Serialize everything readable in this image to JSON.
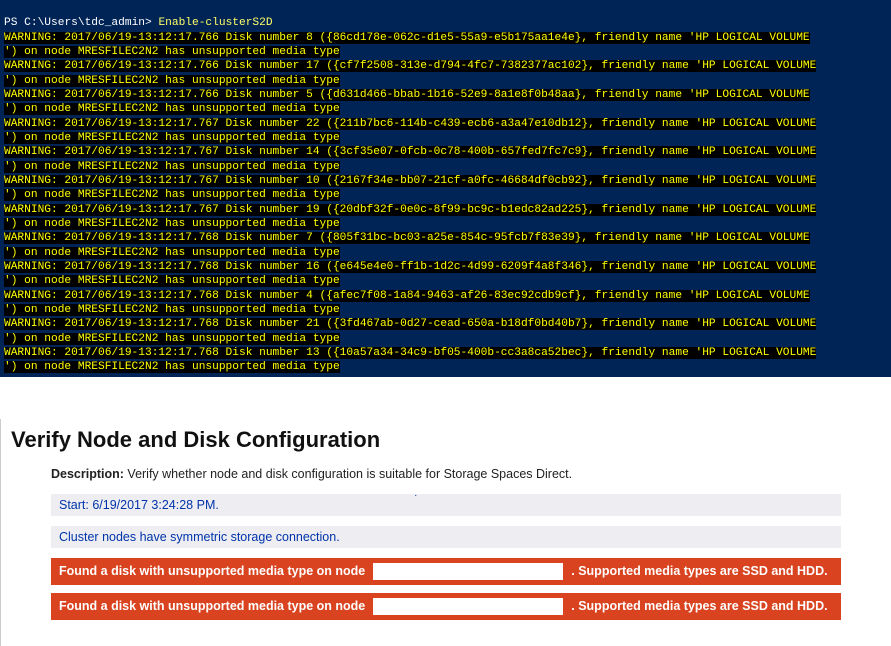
{
  "terminal": {
    "prompt_prefix": "PS ",
    "prompt_path": "C:\\Users\\tdc_admin>",
    "command": "Enable-clusterS2D",
    "node": "MRESFILEC2N2",
    "friendly_name": "HP LOGICAL VOLUME",
    "suffix_msg": "has unsupported media type",
    "warnings": [
      {
        "ts": "2017/06/19-13:12:17.766",
        "disk": "8",
        "guid": "{86cd178e-062c-d1e5-55a9-e5b175aa1e4e}"
      },
      {
        "ts": "2017/06/19-13:12:17.766",
        "disk": "17",
        "guid": "{cf7f2508-313e-d794-4fc7-7382377ac102}"
      },
      {
        "ts": "2017/06/19-13:12:17.766",
        "disk": "5",
        "guid": "{d631d466-bbab-1b16-52e9-8a1e8f0b48aa}"
      },
      {
        "ts": "2017/06/19-13:12:17.767",
        "disk": "22",
        "guid": "{211b7bc6-114b-c439-ecb6-a3a47e10db12}"
      },
      {
        "ts": "2017/06/19-13:12:17.767",
        "disk": "14",
        "guid": "{3cf35e07-0fcb-0c78-400b-657fed7fc7c9}"
      },
      {
        "ts": "2017/06/19-13:12:17.767",
        "disk": "10",
        "guid": "{2167f34e-bb07-21cf-a0fc-46684df0cb92}"
      },
      {
        "ts": "2017/06/19-13:12:17.767",
        "disk": "19",
        "guid": "{20dbf32f-0e0c-8f99-bc9c-b1edc82ad225}"
      },
      {
        "ts": "2017/06/19-13:12:17.768",
        "disk": "7",
        "guid": "{805f31bc-bc03-a25e-854c-95fcb7f83e39}"
      },
      {
        "ts": "2017/06/19-13:12:17.768",
        "disk": "16",
        "guid": "{e645e4e0-ff1b-1d2c-4d99-6209f4a8f346}"
      },
      {
        "ts": "2017/06/19-13:12:17.768",
        "disk": "4",
        "guid": "{afec7f08-1a84-9463-af26-83ec92cdb9cf}"
      },
      {
        "ts": "2017/06/19-13:12:17.768",
        "disk": "21",
        "guid": "{3fd467ab-0d27-cead-650a-b18df0bd40b7}"
      },
      {
        "ts": "2017/06/19-13:12:17.768",
        "disk": "13",
        "guid": "{10a57a34-34c9-bf05-400b-cc3a8ca52bec}"
      }
    ]
  },
  "report": {
    "title": "Verify Node and Disk Configuration",
    "description_label": "Description:",
    "description_text": "Verify whether node and disk configuration is suitable for Storage Spaces Direct.",
    "start_text": "Start: 6/19/2017 3:24:28 PM.",
    "symmetric_text": "Cluster nodes have symmetric storage connection.",
    "error_prefix": "Found a disk with unsupported media type on node",
    "error_suffix": ". Supported media types are SSD and HDD.",
    "error_count": 2
  }
}
